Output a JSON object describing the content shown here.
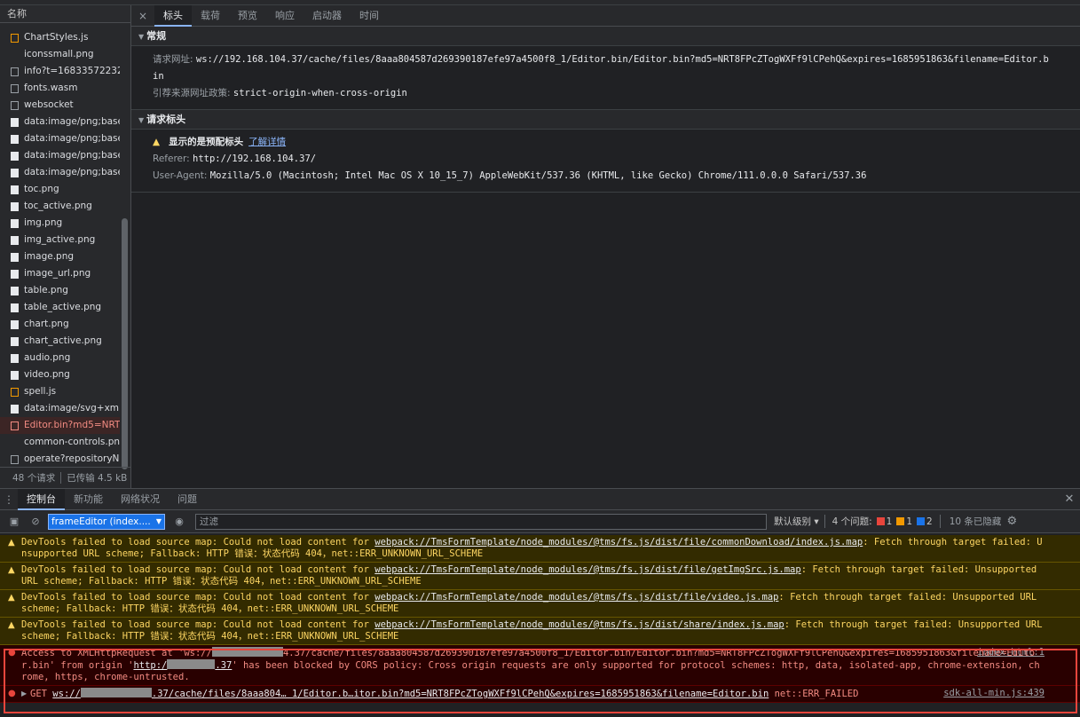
{
  "files": {
    "header": "名称",
    "items": [
      {
        "name": "ChartStyles.js",
        "kind": "js"
      },
      {
        "name": "iconssmall.png",
        "kind": "none"
      },
      {
        "name": "info?t=168335722320",
        "kind": "doc"
      },
      {
        "name": "fonts.wasm",
        "kind": "doc"
      },
      {
        "name": "websocket",
        "kind": "doc"
      },
      {
        "name": "data:image/png;base...",
        "kind": "img"
      },
      {
        "name": "data:image/png;base...",
        "kind": "img"
      },
      {
        "name": "data:image/png;base...",
        "kind": "img"
      },
      {
        "name": "data:image/png;base...",
        "kind": "img"
      },
      {
        "name": "toc.png",
        "kind": "img"
      },
      {
        "name": "toc_active.png",
        "kind": "img"
      },
      {
        "name": "img.png",
        "kind": "img"
      },
      {
        "name": "img_active.png",
        "kind": "img"
      },
      {
        "name": "image.png",
        "kind": "img"
      },
      {
        "name": "image_url.png",
        "kind": "img"
      },
      {
        "name": "table.png",
        "kind": "img"
      },
      {
        "name": "table_active.png",
        "kind": "img"
      },
      {
        "name": "chart.png",
        "kind": "img"
      },
      {
        "name": "chart_active.png",
        "kind": "img"
      },
      {
        "name": "audio.png",
        "kind": "img"
      },
      {
        "name": "video.png",
        "kind": "img"
      },
      {
        "name": "spell.js",
        "kind": "js"
      },
      {
        "name": "data:image/svg+xml;...",
        "kind": "img"
      },
      {
        "name": "Editor.bin?md5=NRT...",
        "kind": "err",
        "error": true
      },
      {
        "name": "common-controls.png",
        "kind": "none"
      },
      {
        "name": "operate?repositoryNa",
        "kind": "doc"
      }
    ],
    "footer": {
      "requests": "48 个请求",
      "transferred": "已传输 4.5 kB"
    }
  },
  "detail": {
    "close": "×",
    "tabs": [
      "标头",
      "载荷",
      "预览",
      "响应",
      "启动器",
      "时间"
    ],
    "general": {
      "title": "常规",
      "request_url_label": "请求网址:",
      "request_url": "ws://192.168.104.37/cache/files/8aaa804587d269390187efe97a4500f8_1/Editor.bin/Editor.bin?md5=NRT8FPcZTogWXFf9lCPehQ&expires=1685951863&filename=Editor.b",
      "request_url_cont": "in",
      "referrer_policy_label": "引荐来源网址政策:",
      "referrer_policy": "strict-origin-when-cross-origin"
    },
    "request_headers": {
      "title": "请求标头",
      "warning": "显示的是预配标头",
      "learn_more": "了解详情",
      "referer_label": "Referer:",
      "referer": "http://192.168.104.37/",
      "ua_label": "User-Agent:",
      "ua": "Mozilla/5.0 (Macintosh; Intel Mac OS X 10_15_7) AppleWebKit/537.36 (KHTML, like Gecko) Chrome/111.0.0.0 Safari/537.36"
    }
  },
  "drawer": {
    "tabs": [
      "控制台",
      "新功能",
      "网络状况",
      "问题"
    ],
    "close": "✕",
    "toolbar": {
      "context": "frameEditor (index....",
      "filter_placeholder": "过滤",
      "level": "默认级别 ▾",
      "issues_label": "4 个问题:",
      "issues_error": "1",
      "issues_warning": "1",
      "issues_info": "2",
      "hidden": "10 条已隐藏"
    },
    "messages": [
      {
        "type": "warning",
        "prefix": "DevTools failed to load source map: Could not load content for ",
        "link": "webpack://TmsFormTemplate/node_modules/@tms/fs.js/dist/file/commonDownload/index.js.map",
        "suffix": ": Fetch through target failed: Unsupported URL scheme; Fallback: HTTP 错误：状态代码 404，net::ERR_UNKNOWN_URL_SCHEME"
      },
      {
        "type": "warning",
        "prefix": "DevTools failed to load source map: Could not load content for ",
        "link": "webpack://TmsFormTemplate/node_modules/@tms/fs.js/dist/file/getImgSrc.js.map",
        "suffix": ": Fetch through target failed: Unsupported URL scheme; Fallback: HTTP 错误：状态代码 404，net::ERR_UNKNOWN_URL_SCHEME"
      },
      {
        "type": "warning",
        "prefix": "DevTools failed to load source map: Could not load content for ",
        "link": "webpack://TmsFormTemplate/node_modules/@tms/fs.js/dist/file/video.js.map",
        "suffix": ": Fetch through target failed: Unsupported URL scheme; Fallback: HTTP 错误：状态代码 404，net::ERR_UNKNOWN_URL_SCHEME"
      },
      {
        "type": "warning",
        "prefix": "DevTools failed to load source map: Could not load content for ",
        "link": "webpack://TmsFormTemplate/node_modules/@tms/fs.js/dist/share/index.js.map",
        "suffix": ": Fetch through target failed: Unsupported URL scheme; Fallback: HTTP 错误：状态代码 404，net::ERR_UNKNOWN_URL_SCHEME"
      }
    ],
    "cors_error": {
      "part1": "Access to XMLHttpRequest at 'ws://",
      "part2": "4.37/cache/files/8aaa804587d269390187efe97a4500f8_1/Editor.bin/Editor.bin?md5=NRT8FPcZTogWXFf9lCPehQ&expires=1685951863&filename=Editor.bin' from origin '",
      "origin_link_a": "http:/",
      "origin_link_b": ".37",
      "part3": "' has been blocked by CORS policy: Cross origin requests are only supported for protocol schemes: http, data, isolated-app, chrome-extension, chrome, https, chrome-untrusted.",
      "source": "index.html:1"
    },
    "net_error": {
      "method": "GET",
      "url_a": "ws://",
      "url_b": ".37/cache/files/8aaa804… 1/Editor.b…itor.bin?md5=NRT8FPcZTogWXFf9lCPehQ&expires=1685951863&filename=Editor.bin",
      "status": "net::ERR_FAILED",
      "source": "sdk-all-min.js:439"
    }
  }
}
